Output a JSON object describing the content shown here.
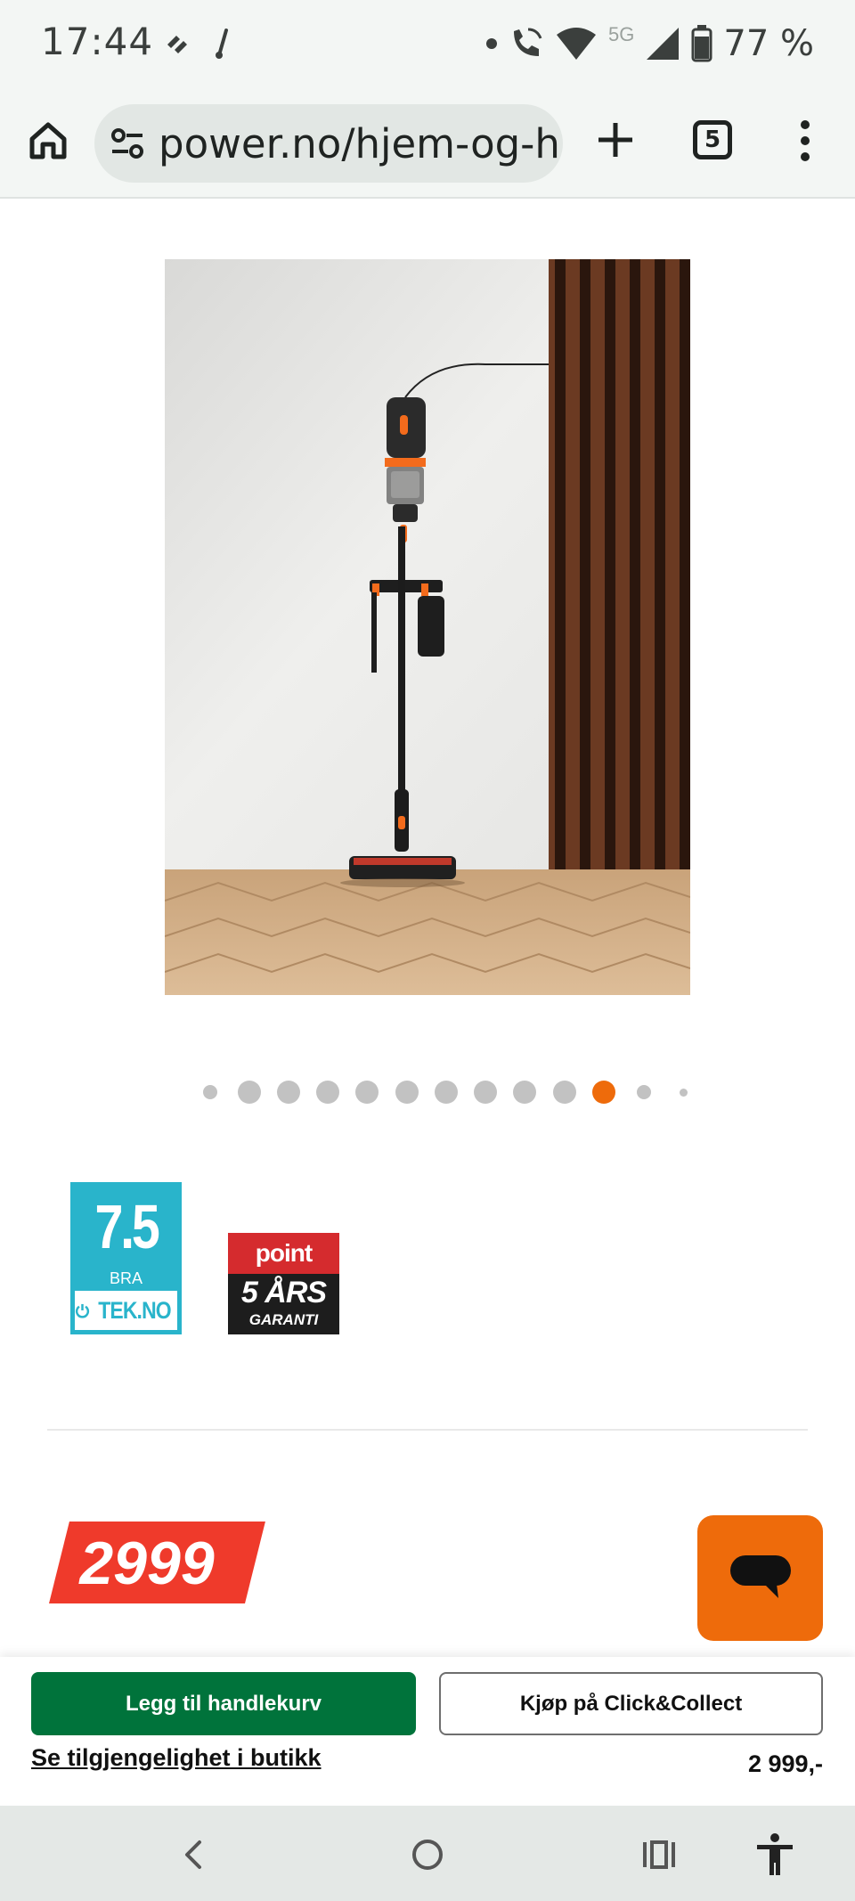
{
  "status_bar": {
    "time": "17:44",
    "network": "5G",
    "battery": "77 %"
  },
  "browser": {
    "url": "power.no/hjem-og-ha",
    "tab_count": "5"
  },
  "product": {
    "image_alt": "Cordless stick vacuum cleaner on wall mount",
    "carousel": {
      "total_dots": 13,
      "active_index": 10
    }
  },
  "badges": {
    "tek": {
      "score": "7.5",
      "label": "BRA",
      "brand": "TEK.NO"
    },
    "point": {
      "logo": "point",
      "years": "5 ÅRS",
      "guarantee": "GARANTI"
    }
  },
  "price": {
    "main": "2999",
    "summary": "2 999,-"
  },
  "actions": {
    "add_to_cart": "Legg til handlekurv",
    "click_collect": "Kjøp på Click&Collect",
    "store_availability": "Se tilgjengelighet i butikk"
  },
  "colors": {
    "accent_orange": "#ee6b0b",
    "cart_green": "#00733b",
    "price_red": "#ef3a2b",
    "tek_blue": "#29b4cb"
  },
  "icons": {
    "home": "home-icon",
    "tune": "tune-icon",
    "new_tab": "plus-icon",
    "menu": "more-vert-icon",
    "chat": "chat-icon",
    "back": "back-icon",
    "home_nav": "home-circle-icon",
    "recents": "recents-icon",
    "accessibility": "accessibility-icon"
  }
}
